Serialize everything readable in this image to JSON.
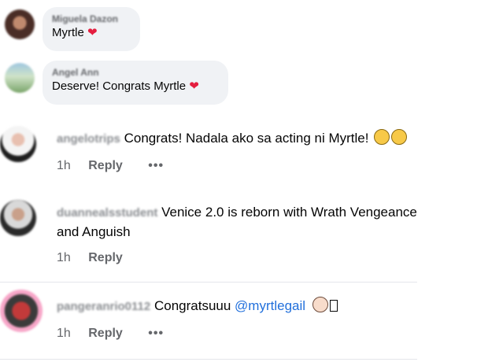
{
  "comments": [
    {
      "author": "Miguela Dazon",
      "text": "Myrtle",
      "emoji": "❤"
    },
    {
      "author": "Angel Ann",
      "text": "Deserve! Congrats Myrtle",
      "emoji": "❤"
    },
    {
      "author": "angelotrips",
      "text": "Congrats! Nadala ako sa acting ni Myrtle!",
      "emoji": "clapping-hands-icon",
      "time": "1h",
      "reply": "Reply",
      "more": "•••"
    },
    {
      "author": "duannealsstudent",
      "text_line1": "Venice 2.0 is reborn with Wrath Vengeance",
      "text_line2": "and Anguish",
      "time": "1h",
      "reply": "Reply"
    },
    {
      "author": "pangeranrio0112",
      "text": "Congratsuuu",
      "mention": "@myrtlegail",
      "emoji": "clapping-hands-icon",
      "time": "1h",
      "reply": "Reply",
      "more": "•••"
    }
  ],
  "colors": {
    "bubble_bg": "#f0f2f5",
    "mention": "#216fdb",
    "heart": "#e41e3f",
    "meta": "#65676b"
  }
}
